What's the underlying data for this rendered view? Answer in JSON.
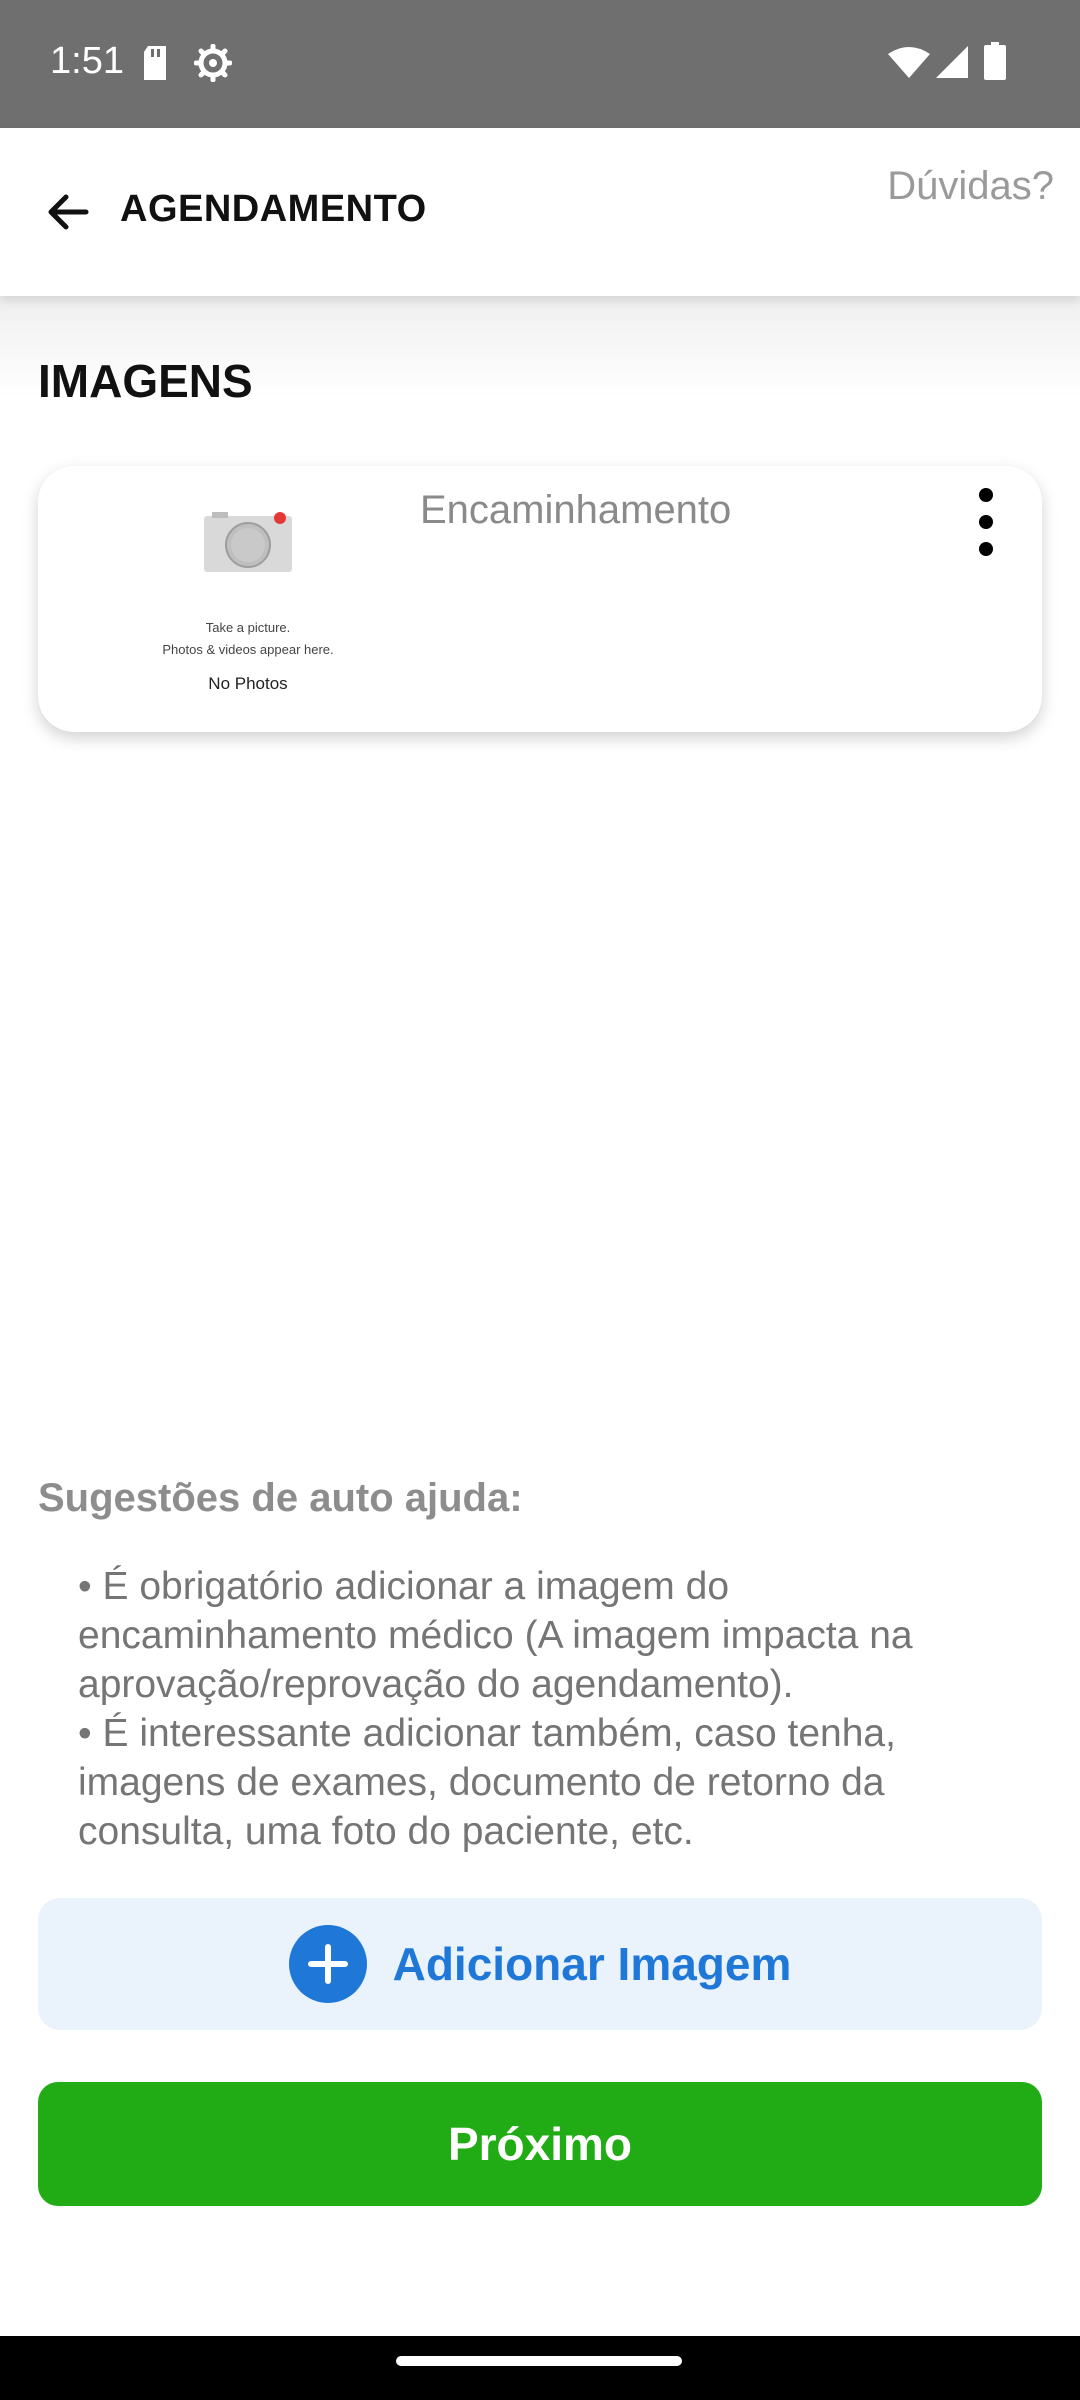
{
  "status_bar": {
    "time": "1:51",
    "left_icons": [
      "sd-card-icon",
      "settings-gear-icon"
    ],
    "right_icons": [
      "wifi-icon",
      "cell-signal-icon",
      "battery-icon"
    ]
  },
  "app_bar": {
    "back_icon": "arrow-left-icon",
    "title": "AGENDAMENTO",
    "help_link": "Dúvidas?"
  },
  "section": {
    "title": "IMAGENS"
  },
  "image_card": {
    "thumbnail": {
      "icon": "camera-icon",
      "line1": "Take a picture.",
      "line2": "Photos & videos appear here.",
      "line3": "No Photos"
    },
    "label": "Encaminhamento",
    "menu_icon": "more-vertical-icon"
  },
  "tips": {
    "title": "Sugestões de auto ajuda:",
    "items": [
      "• É obrigatório adicionar a imagem do encaminhamento médico (A imagem impacta na aprovação/reprovação do agendamento).",
      "• É interessante adicionar também, caso tenha, imagens de exames, documento de retorno da consulta, uma foto do paciente, etc."
    ]
  },
  "actions": {
    "add_image_label": "Adicionar Imagem",
    "add_icon": "plus-circle-icon",
    "next_label": "Próximo"
  },
  "colors": {
    "status_bar": "#6f6f6f",
    "accent_blue": "#1f78d8",
    "add_button_bg": "#eaf2fb",
    "next_green": "#21ac16"
  }
}
